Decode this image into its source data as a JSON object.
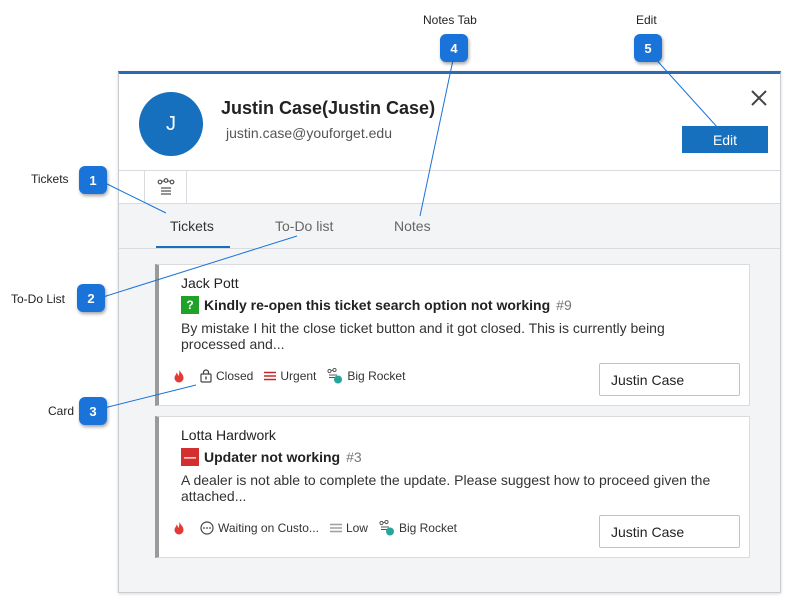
{
  "contact": {
    "avatar_initial": "J",
    "name": "Justin Case(Justin Case)",
    "email": "justin.case@youforget.edu"
  },
  "header": {
    "edit_label": "Edit"
  },
  "tabs": [
    {
      "label": "Tickets",
      "active": true
    },
    {
      "label": "To-Do list",
      "active": false
    },
    {
      "label": "Notes",
      "active": false
    }
  ],
  "tickets": [
    {
      "requester": "Jack Pott",
      "status_color": "#1fa12a",
      "status_glyph": "?",
      "subject": "Kindly re-open this ticket search option not working",
      "number": "#9",
      "description": "By mistake I hit the close ticket button and it got closed. This is currently being processed and...",
      "status": "Closed",
      "priority": "Urgent",
      "priority_color": "#c62828",
      "group": "Big Rocket",
      "assignee": "Justin Case"
    },
    {
      "requester": "Lotta Hardwork",
      "status_color": "#d32f2f",
      "status_glyph": "—",
      "subject": "Updater not working",
      "number": "#3",
      "description": "A dealer is not able to complete the update.  Please suggest how to proceed given the attached...",
      "status": "Waiting on Custo...",
      "priority": "Low",
      "priority_color": "#9e9e9e",
      "group": "Big Rocket",
      "assignee": "Justin Case"
    }
  ],
  "annotations": [
    {
      "number": "1",
      "label": "Tickets"
    },
    {
      "number": "2",
      "label": "To-Do List"
    },
    {
      "number": "3",
      "label": "Card"
    },
    {
      "number": "4",
      "label": "Notes Tab"
    },
    {
      "number": "5",
      "label": "Edit"
    }
  ],
  "colors": {
    "accent": "#1670be",
    "badge": "#1a73d9",
    "group_dot": "#26a69a",
    "fire": "#e53935"
  }
}
